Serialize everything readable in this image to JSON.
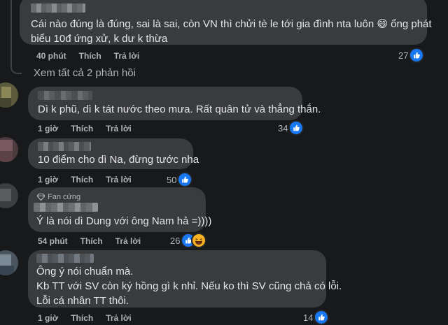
{
  "comments": [
    {
      "lines": [
        "Cái nào đúng là đúng, sai là sai, còn VN thì chửi tè le tới gia đình nta luôn 😄 ổng phát",
        "biểu 10đ ứng xử, k dư k thừa"
      ],
      "time": "40 phút",
      "like": "Thích",
      "reply": "Trả lời",
      "count": "27"
    },
    {
      "lines": [
        "Dì k phũ, dì k tát nước theo mưa. Rất quân tử và thẳng thắn."
      ],
      "time": "1 giờ",
      "like": "Thích",
      "reply": "Trả lời",
      "count": "34"
    },
    {
      "lines": [
        "10 điểm cho dì Na, đừng tước nha"
      ],
      "time": "1 giờ",
      "like": "Thích",
      "reply": "Trả lời",
      "count": "50"
    },
    {
      "badge": "Fan cứng",
      "lines": [
        "Ý là nói dì Dung với ông Nam hả =))))"
      ],
      "time": "54 phút",
      "like": "Thích",
      "reply": "Trả lời",
      "count": "26"
    },
    {
      "lines": [
        "Ông ý nói chuẩn mà.",
        "Kb TT với SV còn ký hồng gì k nhỉ. Nếu ko thì SV cũng chả có lỗi.",
        "Lỗi cá nhân TT thôi."
      ],
      "time": "1 giờ",
      "like": "Thích",
      "reply": "Trả lời",
      "count": "14"
    }
  ],
  "see_all": "Xem tất cả 2 phản hồi",
  "colors": {
    "background": "#18191a",
    "bubble": "#3a3b3c",
    "like_blue": "#1877f2",
    "meta_gray": "#b0b3b8"
  },
  "icons": [
    "like-icon",
    "haha-icon",
    "diamond-icon",
    "reply-arrow-icon"
  ]
}
